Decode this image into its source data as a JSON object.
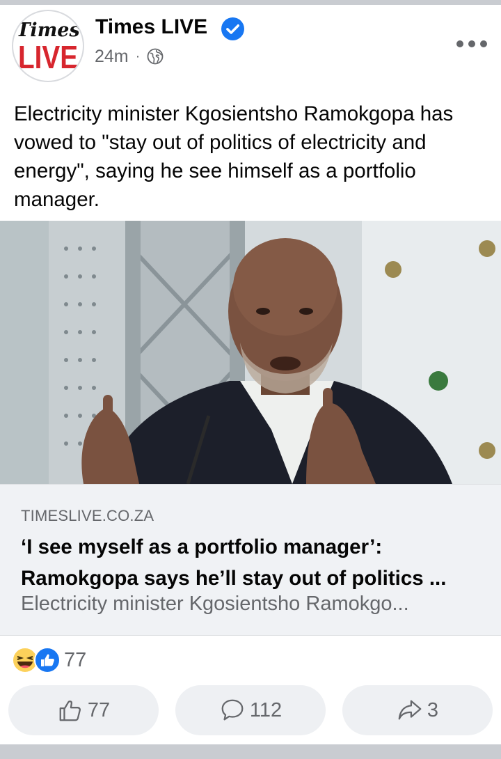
{
  "post": {
    "page_name": "Times LIVE",
    "avatar_logo": {
      "line1": "Times",
      "line2": "LIVE"
    },
    "timestamp": "24m",
    "separator": "·",
    "audience_icon": "globe-icon",
    "menu_icon": "more-options-icon",
    "caption": "Electricity minister Kgosientsho Ramokgopa has vowed to \"stay out of politics of electricity and energy\", saying he see himself as a portfolio manager."
  },
  "link_preview": {
    "domain": "TIMESLIVE.CO.ZA",
    "headline": "‘I see myself as a portfolio manager’: Ramokgopa says he’ll stay out of politics ...",
    "description": "Electricity minister Kgosientsho Ramokgo..."
  },
  "reactions": {
    "icons": [
      "haha-icon",
      "like-icon"
    ],
    "count": "77"
  },
  "actions": {
    "like_count": "77",
    "comment_count": "112",
    "share_count": "3"
  },
  "colors": {
    "accent_blue": "#1877f2",
    "secondary_text": "#65676b",
    "button_bg": "#eef0f3",
    "logo_red": "#d7262e"
  }
}
